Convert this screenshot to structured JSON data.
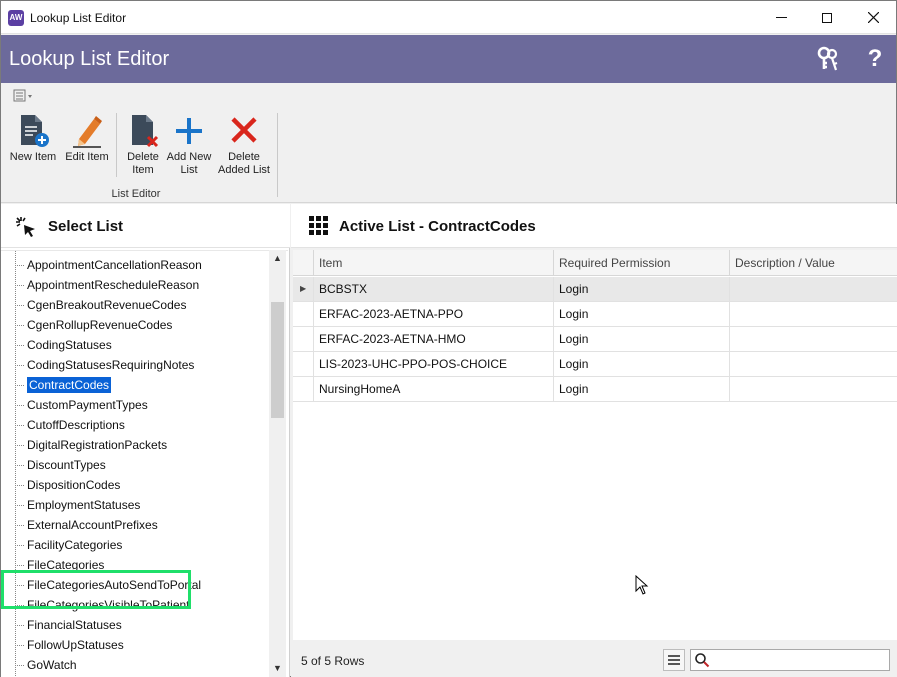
{
  "window": {
    "title": "Lookup List Editor",
    "icon_text": "AW"
  },
  "header": {
    "title": "Lookup List Editor",
    "icons": [
      "keys-icon",
      "help-icon"
    ],
    "help_glyph": "?"
  },
  "ribbon": {
    "buttons": [
      {
        "label": "New Item",
        "icon": "new-item-icon"
      },
      {
        "label": "Edit Item",
        "icon": "edit-item-icon"
      },
      {
        "label": "Delete Item",
        "icon": "delete-item-icon"
      },
      {
        "label": "Add New List",
        "icon": "plus-icon"
      },
      {
        "label": "Delete Added List",
        "icon": "red-x-icon"
      }
    ],
    "group_label": "List Editor"
  },
  "select_list": {
    "title": "Select List",
    "items": [
      "AppointmentCancellationReason",
      "AppointmentRescheduleReason",
      "CgenBreakoutRevenueCodes",
      "CgenRollupRevenueCodes",
      "CodingStatuses",
      "CodingStatusesRequiringNotes",
      "ContractCodes",
      "CustomPaymentTypes",
      "CutoffDescriptions",
      "DigitalRegistrationPackets",
      "DiscountTypes",
      "DispositionCodes",
      "EmploymentStatuses",
      "ExternalAccountPrefixes",
      "FacilityCategories",
      "FileCategories",
      "FileCategoriesAutoSendToPortal",
      "FileCategoriesVisibleToPatient",
      "FinancialStatuses",
      "FollowUpStatuses",
      "GoWatch"
    ],
    "selected": "ContractCodes",
    "highlight_color": "#1fdf6a"
  },
  "active_list": {
    "title": "Active List - ContractCodes",
    "columns": [
      "Item",
      "Required Permission",
      "Description / Value"
    ],
    "rows": [
      {
        "item": "BCBSTX",
        "permission": "Login",
        "description": ""
      },
      {
        "item": "ERFAC-2023-AETNA-PPO",
        "permission": "Login",
        "description": ""
      },
      {
        "item": "ERFAC-2023-AETNA-HMO",
        "permission": "Login",
        "description": ""
      },
      {
        "item": "LIS-2023-UHC-PPO-POS-CHOICE",
        "permission": "Login",
        "description": ""
      },
      {
        "item": "NursingHomeA",
        "permission": "Login",
        "description": ""
      }
    ],
    "current_row_marker": "▶",
    "row_count": "5 of 5 Rows",
    "search": {
      "value": "",
      "placeholder": ""
    }
  },
  "colors": {
    "header_bg": "#6c6a9b",
    "selection": "#0a62d6",
    "delete_red": "#d9261c",
    "add_blue": "#1a74c9"
  }
}
